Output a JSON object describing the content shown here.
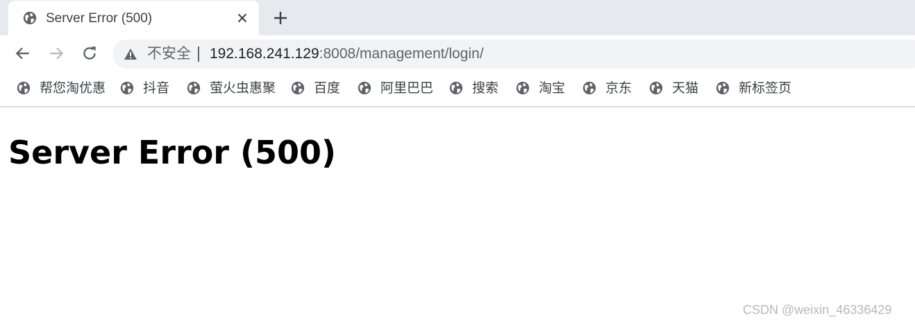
{
  "tab": {
    "title": "Server Error (500)",
    "favicon": "globe-icon",
    "close_icon": "close-icon"
  },
  "new_tab_icon": "plus-icon",
  "toolbar": {
    "back_icon": "back-arrow-icon",
    "forward_icon": "forward-arrow-icon",
    "reload_icon": "reload-icon"
  },
  "omnibox": {
    "security_icon": "warning-triangle-icon",
    "security_label": "不安全",
    "url_host": "192.168.241.129",
    "url_rest": ":8008/management/login/"
  },
  "bookmarks": [
    {
      "label": "帮您淘优惠",
      "icon": "globe-icon"
    },
    {
      "label": "抖音",
      "icon": "globe-icon"
    },
    {
      "label": "萤火虫惠聚",
      "icon": "globe-icon"
    },
    {
      "label": "百度",
      "icon": "globe-icon"
    },
    {
      "label": "阿里巴巴",
      "icon": "globe-icon"
    },
    {
      "label": "搜索",
      "icon": "globe-icon"
    },
    {
      "label": "淘宝",
      "icon": "globe-icon"
    },
    {
      "label": "京东",
      "icon": "globe-icon"
    },
    {
      "label": "天猫",
      "icon": "globe-icon"
    },
    {
      "label": "新标签页",
      "icon": "globe-icon"
    }
  ],
  "page": {
    "heading": "Server Error (500)"
  },
  "watermark": "CSDN @weixin_46336429",
  "colors": {
    "tabstrip_bg": "#e6e9ed",
    "omnibox_bg": "#f1f3f4",
    "icon_gray": "#5f6368",
    "watermark": "#b8b8b8"
  }
}
